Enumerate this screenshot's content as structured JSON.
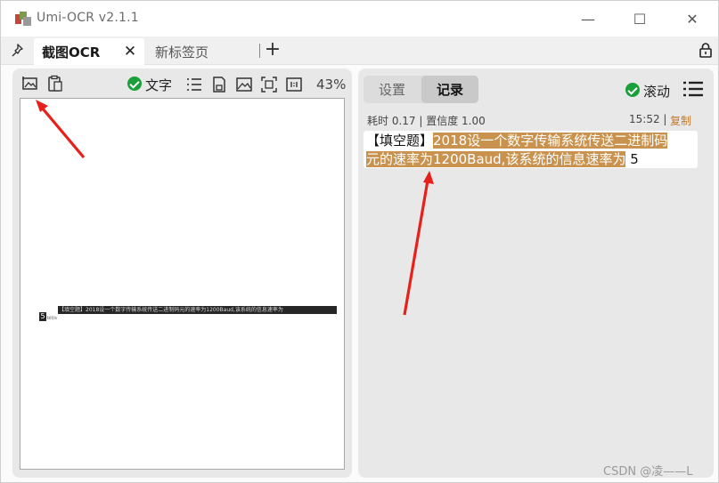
{
  "window": {
    "title": "Umi-OCR v2.1.1",
    "controls": {
      "minimize": "—",
      "maximize": "☐",
      "close": "✕"
    }
  },
  "tabs": {
    "items": [
      {
        "label": "截图OCR",
        "active": true,
        "close": "✕"
      },
      {
        "label": "新标签页",
        "active": false
      }
    ],
    "add": "+"
  },
  "left_panel": {
    "text_toggle_label": "文字",
    "zoom": "43%",
    "screenshot": {
      "line": "【填空题】2018设一个数字传输系统传送二进制码元的速率为1200Baud,该系统的信息速率为",
      "answer": "5",
      "small": "bit/s"
    }
  },
  "right_panel": {
    "tabs": {
      "settings": "设置",
      "records": "记录"
    },
    "scroll_label": "滚动",
    "record": {
      "meta": "耗时 0.17 | 置信度 1.00",
      "time": "15:52 |",
      "copy": "复制",
      "line1_plain": "【填空题】",
      "line1_hl": "2018设一个数字传输系统传送二进制码",
      "line2_hl": "元的速率为1200Baud,该系统的信息速率为",
      "line2_plain": "5"
    }
  },
  "watermark": "CSDN @凌——L",
  "colors": {
    "check": "#1a9f3a",
    "highlight": "#c9934f",
    "copy": "#c47a2c",
    "arrow": "#e8201c"
  }
}
